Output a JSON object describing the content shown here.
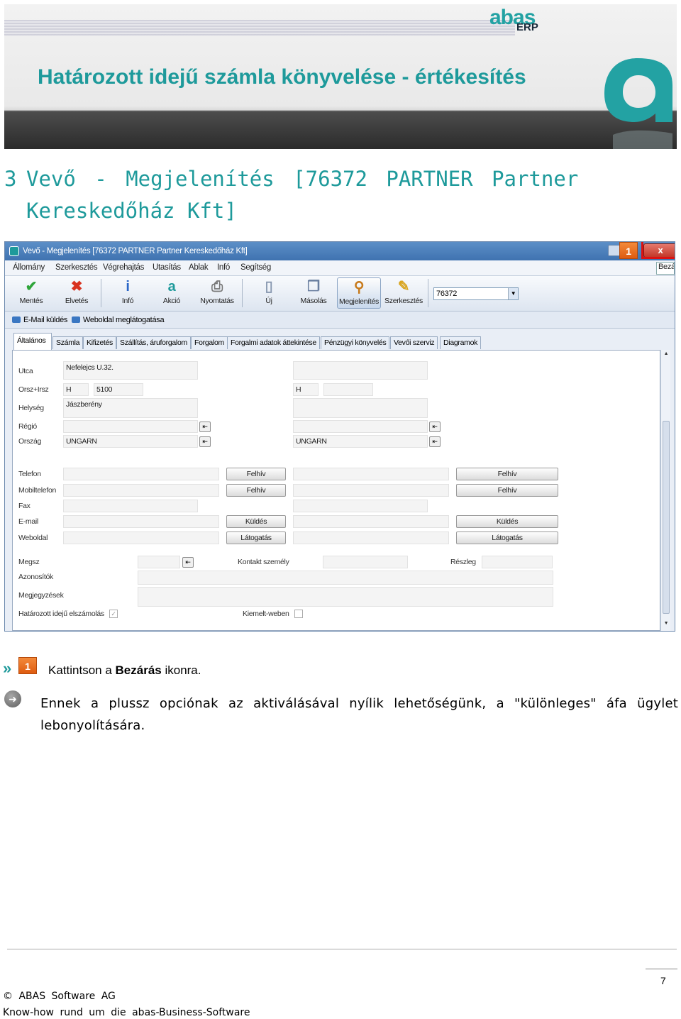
{
  "banner": {
    "title": "Határozott idejű számla könyvelése - értékesítés",
    "logo_text": "abas",
    "logo_sub": "ERP"
  },
  "section": {
    "number": "3",
    "title_line1": "Vevő - Megjelenítés  [76372  PARTNER  Partner",
    "title_line2": "Kereskedőház Kft]"
  },
  "window": {
    "title": "Vevő - Megjelenítés [76372  PARTNER  Partner Kereskedőház Kft]",
    "close_label": "x",
    "badge": "1",
    "menu": [
      "Állomány",
      "Szerkesztés",
      "Végrehajtás",
      "Utasítás",
      "Ablak",
      "Infó",
      "Segítség"
    ],
    "menu_overflow": "Bezá",
    "toolbar": {
      "save": "Mentés",
      "discard": "Elvetés",
      "info": "Infó",
      "action": "Akció",
      "print": "Nyomtatás",
      "new": "Új",
      "copy": "Másolás",
      "display": "Megjelenítés",
      "edit": "Szerkesztés",
      "search_value": "76372"
    },
    "subbar": {
      "email": "E-Mail küldés",
      "web": "Weboldal meglátogatása"
    },
    "tabs": [
      "Általános",
      "Számla",
      "Kifizetés",
      "Szállítás, áruforgalom",
      "Forgalom",
      "Forgalmi adatok áttekintése",
      "Pénzügyi könyvelés",
      "Vevői szerviz",
      "Diagramok"
    ],
    "labels": {
      "street": "Utca",
      "country_zip": "Orsz+Irsz",
      "city": "Helység",
      "region": "Régió",
      "country": "Ország",
      "phone": "Telefon",
      "mobile": "Mobiltelefon",
      "fax": "Fax",
      "email": "E-mail",
      "website": "Weboldal",
      "megsz": "Megsz",
      "ids": "Azonosítók",
      "notes": "Megjegyzések",
      "fixed_term": "Határozott idejű elszámolás",
      "contact": "Kontakt személy",
      "detail": "Részleg",
      "highlighted": "Kiemelt-weben"
    },
    "values": {
      "street": "Nefelejcs U.32.",
      "country_code": "H",
      "zip": "5100",
      "city": "Jászberény",
      "country": "UNGARN",
      "country_code_right": "H",
      "country_right": "UNGARN"
    },
    "buttons": {
      "call": "Felhív",
      "send": "Küldés",
      "visit": "Látogatás"
    }
  },
  "step": {
    "badge": "1",
    "text_before": "Kattintson   a ",
    "text_bold": "Bezárás",
    "text_after": " ikonra."
  },
  "note": "Ennek a plussz opciónak az  aktiválásával nyílik lehetőségünk, a \"különleges\" áfa ügylet lebonyolítására.",
  "footer": {
    "page": "7",
    "copyright": "©  ABAS Software AG",
    "tagline": "Know-how rund um die abas-Business-Software"
  },
  "colors": {
    "accent": "#1e9a9b",
    "badge": "#e8681f",
    "close": "#c2382a"
  }
}
